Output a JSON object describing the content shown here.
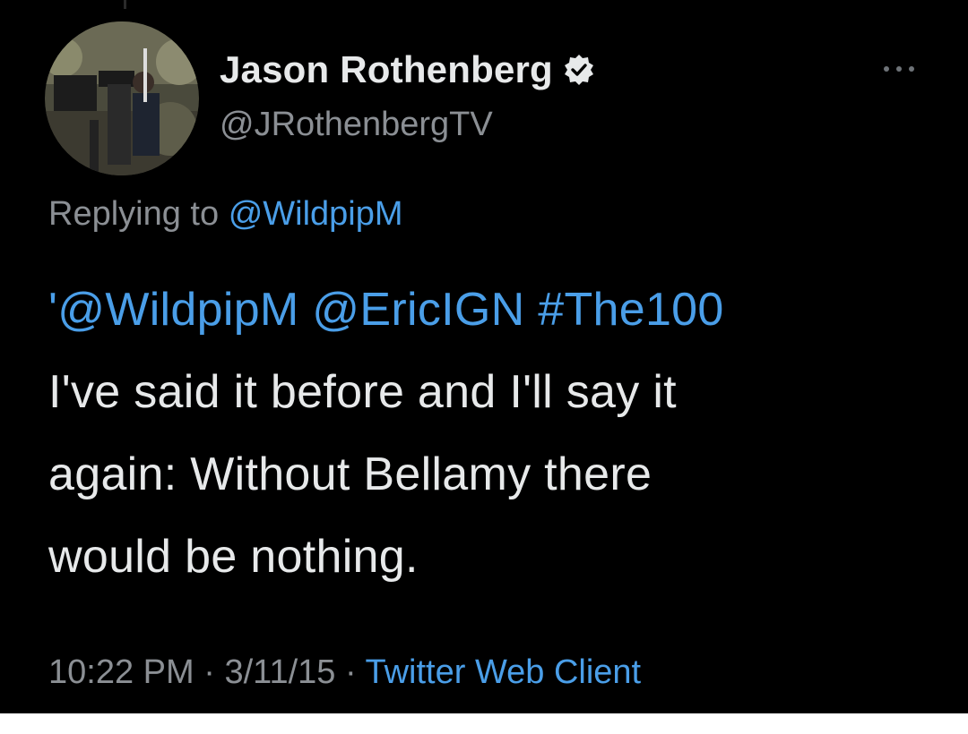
{
  "author": {
    "name": "Jason Rothenberg",
    "handle": "@JRothenbergTV",
    "verified_icon": "verified-badge-icon"
  },
  "reply": {
    "prefix": "Replying to",
    "mention": "@WildpipM"
  },
  "tweet": {
    "mentions_prefix": "'",
    "mention_1": "@WildpipM",
    "mention_2": "@EricIGN",
    "hashtag": "#The100",
    "line_2": "I've said it before and I'll say it",
    "line_3": "again: Without Bellamy there",
    "line_4": "would be nothing."
  },
  "meta": {
    "time": "10:22 PM",
    "separator": "·",
    "date": "3/11/15",
    "client": "Twitter Web Client"
  },
  "colors": {
    "background": "#000000",
    "text": "#e7e9ea",
    "secondary": "#8b8f94",
    "link": "#4a9ee8"
  }
}
